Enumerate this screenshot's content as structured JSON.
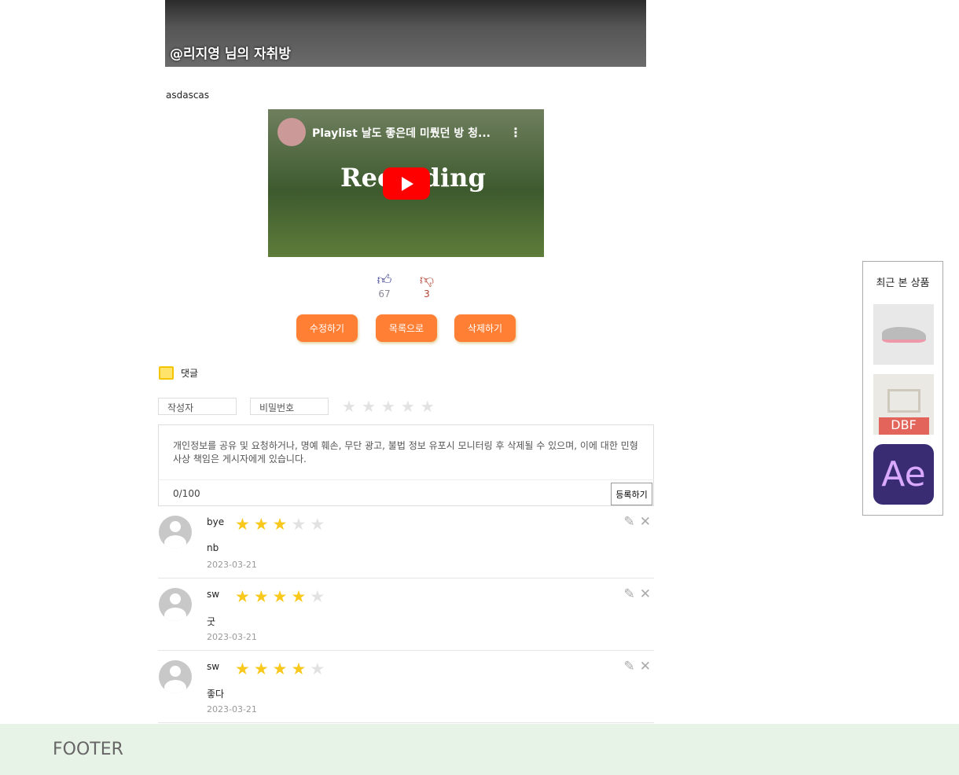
{
  "post": {
    "image_caption": "@리지영 님의 자취방",
    "body_text": "asdascas",
    "video": {
      "title": "Playlist 날도 좋은데 미뤘던 방 청...",
      "overlay_text": "Recording",
      "play_icon": "youtube-play-icon"
    },
    "likes": "67",
    "dislikes": "3"
  },
  "actions": {
    "edit": "수정하기",
    "list": "목록으로",
    "delete": "삭제하기"
  },
  "comment_form": {
    "heading": "댓글",
    "author_placeholder": "작성자",
    "password_placeholder": "비밀번호",
    "rating": 0,
    "placeholder": "개인정보를 공유 및 요청하거나, 명예 훼손, 무단 광고, 불법 정보 유포시 모니터링 후 삭제될 수 있으며, 이에 대한 민형사상 책임은 게시자에게 있습니다.",
    "counter": "0/100",
    "submit": "등록하기"
  },
  "comments": [
    {
      "author": "bye",
      "rating": 3,
      "text": "nb",
      "date": "2023-03-21"
    },
    {
      "author": "sw",
      "rating": 4,
      "text": "굿",
      "date": "2023-03-21"
    },
    {
      "author": "sw",
      "rating": 4,
      "text": "좋다",
      "date": "2023-03-21"
    }
  ],
  "footer": "FOOTER",
  "recent": {
    "title": "최근 본 상품",
    "items": [
      {
        "label": "sneaker"
      },
      {
        "label": "DBF"
      },
      {
        "label": "Ae"
      }
    ]
  },
  "colors": {
    "accent": "#ff7f35",
    "star": "#f8c91c",
    "footer_bg": "#e8f3e8"
  }
}
